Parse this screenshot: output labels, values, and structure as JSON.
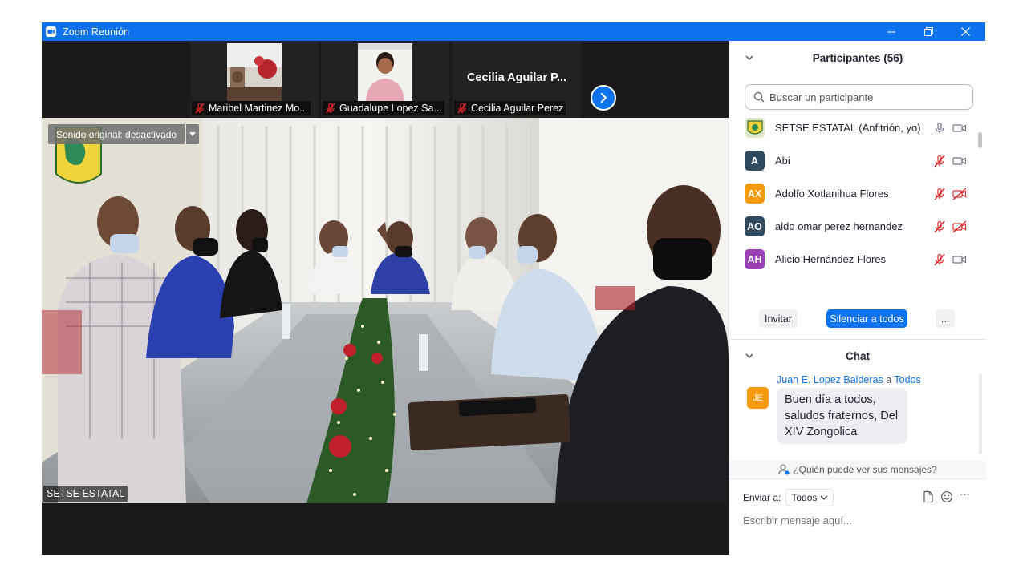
{
  "window": {
    "title": "Zoom Reunión",
    "minimize_icon": "minimize-icon",
    "restore_icon": "restore-icon",
    "close_icon": "close-icon"
  },
  "thumbnails": [
    {
      "name": "Maribel Martinez Mo...",
      "muted": true,
      "has_video": true
    },
    {
      "name": "Guadalupe Lopez Sa...",
      "muted": true,
      "has_video": true
    },
    {
      "name": "Cecilia Aguilar Perez",
      "display": "Cecilia  Aguilar  P...",
      "muted": true,
      "has_video": false
    }
  ],
  "main_video": {
    "speaker": "SETSE ESTATAL",
    "original_sound": "Sonido original: desactivado"
  },
  "participants": {
    "title": "Participantes (56)",
    "search_placeholder": "Buscar un participante",
    "list": [
      {
        "initials": "",
        "name": "SETSE ESTATAL (Anfitrión, yo)",
        "color": "#c8d6a0",
        "mic": "on",
        "cam": "on"
      },
      {
        "initials": "A",
        "name": "Abi",
        "color": "#2f4a5e",
        "mic": "muted",
        "cam": "on"
      },
      {
        "initials": "AX",
        "name": "Adolfo Xotlanihua Flores",
        "color": "#f59a0d",
        "mic": "muted",
        "cam": "off"
      },
      {
        "initials": "AO",
        "name": "aldo omar perez hernandez",
        "color": "#2f4a5e",
        "mic": "muted",
        "cam": "off"
      },
      {
        "initials": "AH",
        "name": "Alicio Hernández Flores",
        "color": "#9b3fb5",
        "mic": "muted",
        "cam": "on"
      }
    ],
    "invite_label": "Invitar",
    "mute_all_label": "Silenciar a todos",
    "more_label": "..."
  },
  "chat": {
    "title": "Chat",
    "messages": [
      {
        "sender": "Juan E. Lopez Balderas",
        "to_word": "a",
        "recipient": "Todos",
        "initials": "JE",
        "text": "Buen día a todos, saludos fraternos, Del XIV Zongolica"
      }
    ],
    "who_can_see": "¿Quién puede ver sus mensajes?",
    "send_to_label": "Enviar a:",
    "send_to_value": "Todos",
    "input_placeholder": "Escribir mensaje aquí...",
    "more_label": "···"
  },
  "colors": {
    "accent": "#0e72ed",
    "muted_red": "#e02828",
    "dark_bg": "#1a1a1a"
  }
}
